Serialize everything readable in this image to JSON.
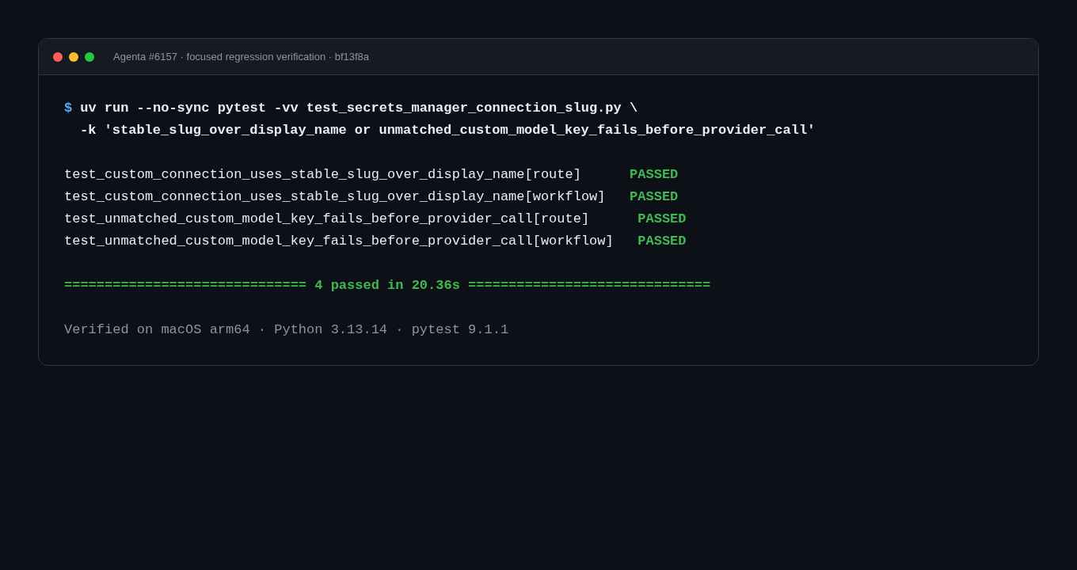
{
  "window": {
    "title": "Agenta #6157 · focused regression verification · bf13f8a"
  },
  "command": {
    "prompt": "$",
    "line": "uv run --no-sync pytest -vv test_secrets_manager_connection_slug.py \\",
    "continuation": "-k 'stable_slug_over_display_name or unmatched_custom_model_key_fails_before_provider_call'"
  },
  "results": [
    {
      "name": "test_custom_connection_uses_stable_slug_over_display_name[route]",
      "status": "PASSED",
      "kind": "passed"
    },
    {
      "name": "test_custom_connection_uses_stable_slug_over_display_name[workflow]",
      "status": "PASSED",
      "kind": "passed"
    },
    {
      "name": "test_unmatched_custom_model_key_fails_before_provider_call[route]",
      "status": "PASSED",
      "kind": "passed"
    },
    {
      "name": "test_unmatched_custom_model_key_fails_before_provider_call[workflow]",
      "status": "PASSED",
      "kind": "passed"
    }
  ],
  "summary": "============================== 4 passed in 20.36s ==============================",
  "footer": "Verified on macOS arm64 · Python 3.13.14 · pytest 9.1.1"
}
